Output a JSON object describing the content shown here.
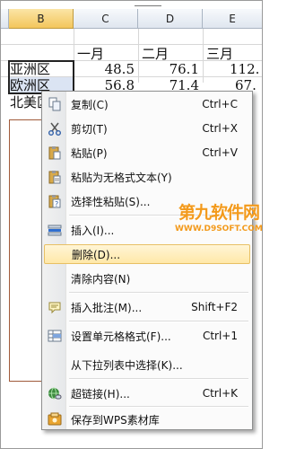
{
  "sheet": {
    "columns": [
      "B",
      "C",
      "D",
      "E"
    ],
    "month_headers": [
      "一月",
      "二月",
      "三月"
    ],
    "rows": [
      {
        "region": "亚洲区",
        "values": [
          "48.5",
          "76.1",
          "112."
        ]
      },
      {
        "region": "欧洲区",
        "values": [
          "56.8",
          "71.4",
          "67."
        ]
      },
      {
        "region": "北美区",
        "values": [
          "",
          "",
          ""
        ]
      }
    ]
  },
  "menu": {
    "items": [
      {
        "label": "复制(C)",
        "shortcut": "Ctrl+C",
        "icon": "copy-icon"
      },
      {
        "label": "剪切(T)",
        "shortcut": "Ctrl+X",
        "icon": "scissors-icon"
      },
      {
        "label": "粘贴(P)",
        "shortcut": "Ctrl+V",
        "icon": "paste-icon"
      },
      {
        "label": "粘贴为无格式文本(Y)",
        "shortcut": "",
        "icon": "paste-text-icon"
      },
      {
        "label": "选择性粘贴(S)...",
        "shortcut": "",
        "icon": "paste-special-icon"
      },
      {
        "label": "插入(I)...",
        "shortcut": "",
        "icon": "insert-icon"
      },
      {
        "label": "删除(D)...",
        "shortcut": "",
        "icon": ""
      },
      {
        "label": "清除内容(N)",
        "shortcut": "",
        "icon": ""
      },
      {
        "label": "插入批注(M)...",
        "shortcut": "Shift+F2",
        "icon": "comment-icon"
      },
      {
        "label": "设置单元格格式(F)...",
        "shortcut": "Ctrl+1",
        "icon": "format-cells-icon"
      },
      {
        "label": "从下拉列表中选择(K)...",
        "shortcut": "",
        "icon": ""
      },
      {
        "label": "超链接(H)...",
        "shortcut": "Ctrl+K",
        "icon": "hyperlink-icon"
      },
      {
        "label": "保存到WPS素材库",
        "shortcut": "",
        "icon": "save-library-icon"
      }
    ],
    "highlighted": "删除(D)..."
  },
  "watermark": {
    "title": "第九软件网",
    "url": "WWW.D9SOFT.COM"
  },
  "colors": {
    "highlight": "#ffe8a8",
    "watermark": "#f39a1c",
    "chart_border": "#a05a3a"
  }
}
